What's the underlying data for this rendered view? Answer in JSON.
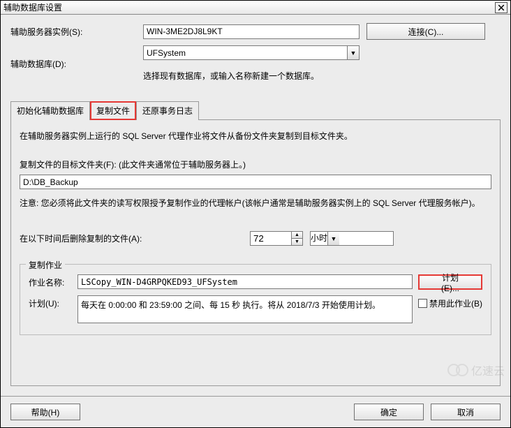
{
  "window": {
    "title": "辅助数据库设置"
  },
  "form": {
    "server_label": "辅助服务器实例(S):",
    "server_value": "WIN-3ME2DJ8L9KT",
    "connect_btn": "连接(C)...",
    "database_label": "辅助数据库(D):",
    "database_value": "UFSystem",
    "database_hint": "选择现有数据库，或输入名称新建一个数据库。"
  },
  "tabs": {
    "init": "初始化辅助数据库",
    "copy": "复制文件",
    "restore": "还原事务日志"
  },
  "copy_tab": {
    "desc": "在辅助服务器实例上运行的 SQL Server 代理作业将文件从备份文件夹复制到目标文件夹。",
    "dest_label": "复制文件的目标文件夹(F):  (此文件夹通常位于辅助服务器上。)",
    "dest_value": "D:\\DB_Backup",
    "note": "注意:   您必须将此文件夹的读写权限授予复制作业的代理帐户(该帐户通常是辅助服务器实例上的 SQL Server 代理服务帐户)。",
    "delete_label": "在以下时间后删除复制的文件(A):",
    "delete_value": "72",
    "delete_unit": "小时"
  },
  "job": {
    "legend": "复制作业",
    "name_label": "作业名称:",
    "name_value": "LSCopy_WIN-D4GRPQKED93_UFSystem",
    "plan_btn": "计划(E)...",
    "schedule_label": "计划(U):",
    "schedule_text": "每天在 0:00:00 和 23:59:00 之间、每 15 秒 执行。将从 2018/7/3 开始使用计划。",
    "disable_label": "禁用此作业(B)"
  },
  "buttons": {
    "help": "帮助(H)",
    "ok": "确定",
    "cancel": "取消"
  },
  "watermark": "亿速云"
}
